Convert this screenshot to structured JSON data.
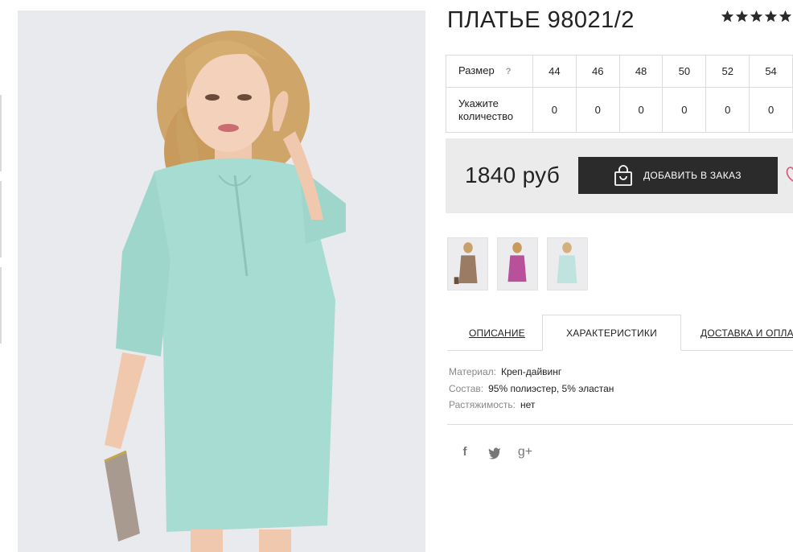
{
  "product": {
    "title": "ПЛАТЬЕ 98021/2",
    "rating_stars": 5
  },
  "sizes": {
    "size_label": "Размер",
    "help_label": "?",
    "qty_label": "Укажите количество",
    "items": [
      {
        "size": "44",
        "qty": "0"
      },
      {
        "size": "46",
        "qty": "0"
      },
      {
        "size": "48",
        "qty": "0"
      },
      {
        "size": "50",
        "qty": "0"
      },
      {
        "size": "52",
        "qty": "0"
      },
      {
        "size": "54",
        "qty": "0"
      }
    ]
  },
  "price": {
    "value": "1840 руб",
    "order_button": "ДОБАВИТЬ В ЗАКАЗ"
  },
  "thumbnails": [
    {
      "name": "thumb-brown",
      "color": "#9a7b63"
    },
    {
      "name": "thumb-pink",
      "color": "#b9509a"
    },
    {
      "name": "thumb-mint",
      "color": "#bfe4df"
    }
  ],
  "tabs": [
    {
      "label": "ОПИСАНИЕ",
      "active": false
    },
    {
      "label": "ХАРАКТЕРИСТИКИ",
      "active": true
    },
    {
      "label": "ДОСТАВКА И ОПЛАТА",
      "active": false
    }
  ],
  "specs": [
    {
      "label": "Материал:",
      "value": "Креп-дайвинг"
    },
    {
      "label": "Состав:",
      "value": "95% полиэстер, 5% эластан"
    },
    {
      "label": "Растяжимость:",
      "value": "нет"
    }
  ],
  "social": [
    {
      "name": "facebook-icon",
      "glyph": "f"
    },
    {
      "name": "twitter-icon",
      "glyph": "t"
    },
    {
      "name": "google-plus-icon",
      "glyph": "g+"
    }
  ],
  "colors": {
    "dress": "#9fd8cd",
    "button_bg": "#2b2b2b",
    "price_bg": "#ebebeb",
    "accent_heart": "#d9547a"
  }
}
